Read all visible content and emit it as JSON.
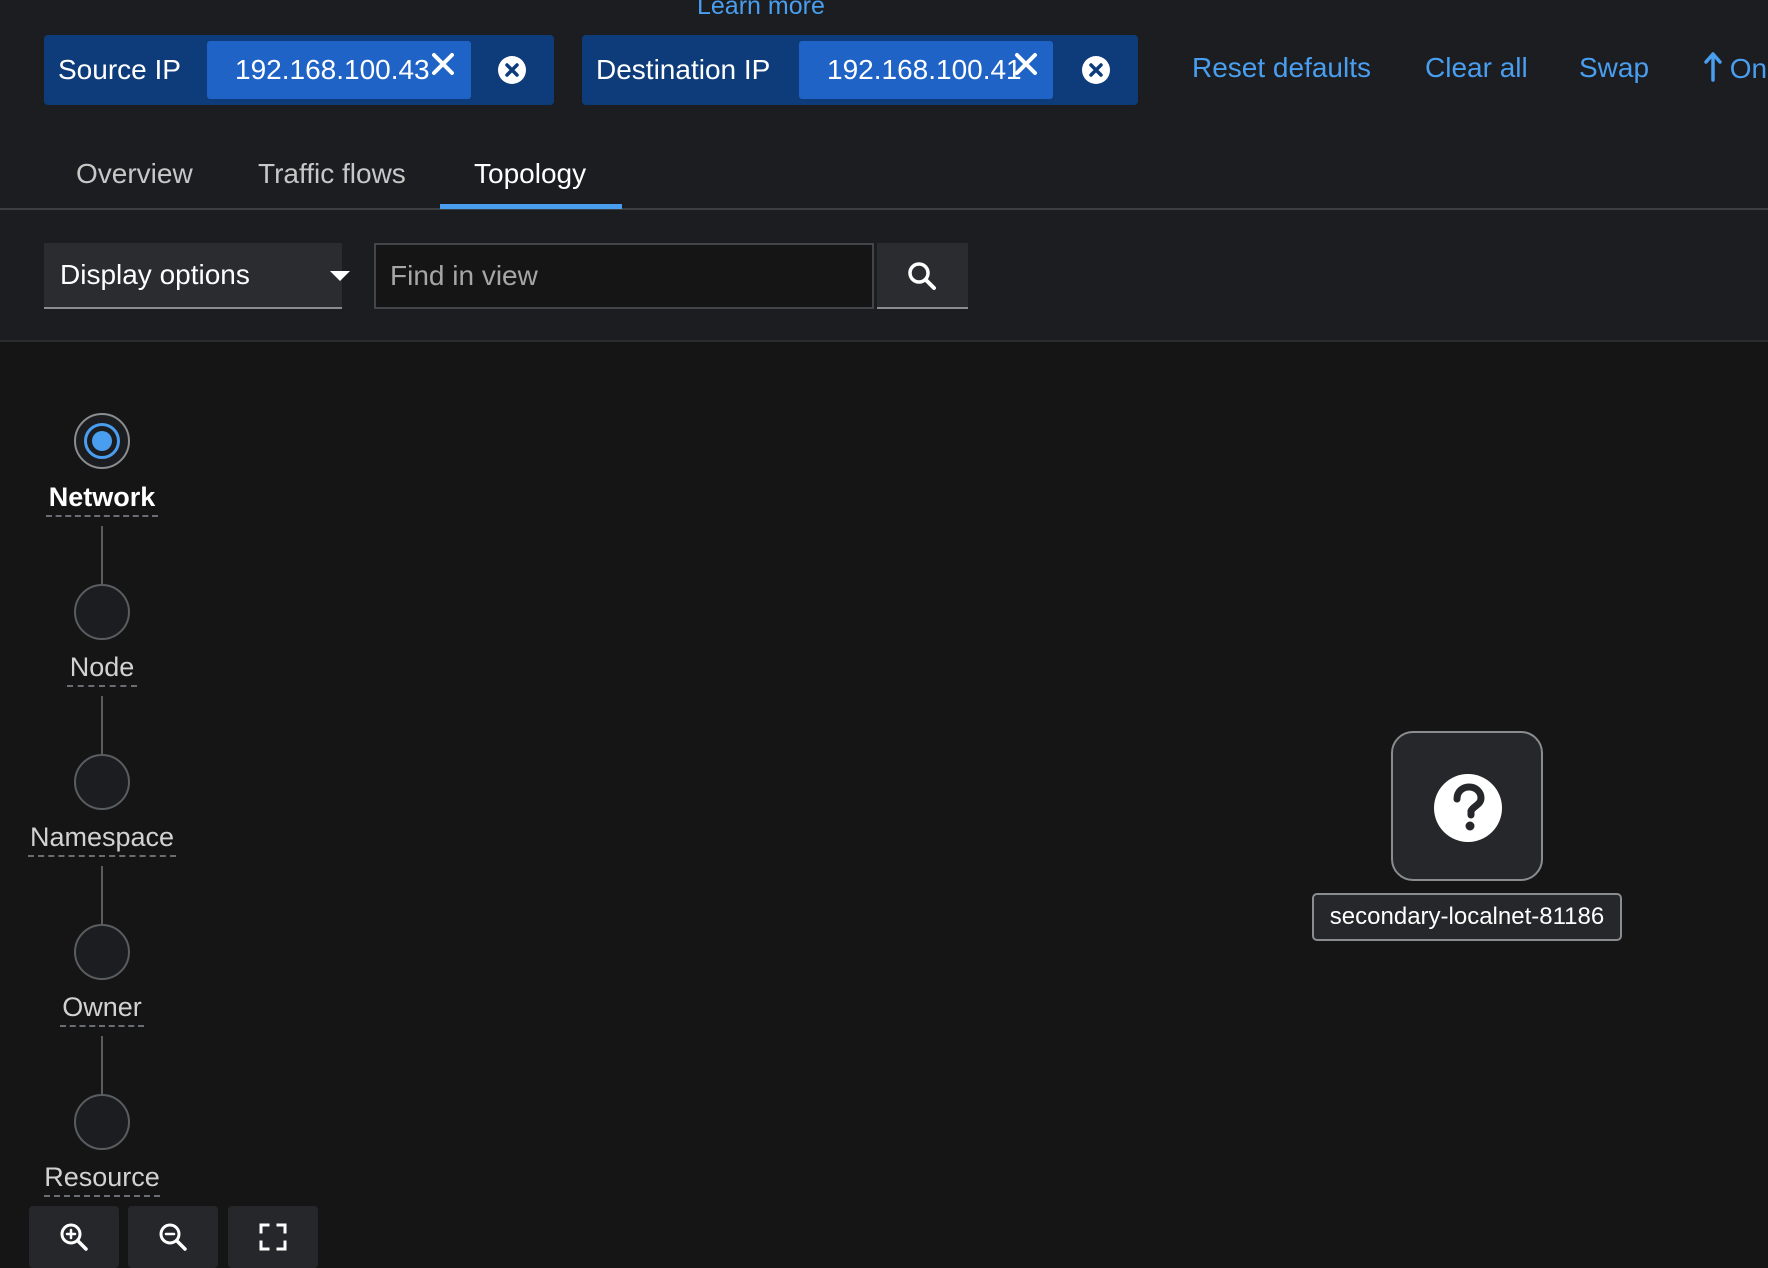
{
  "header": {
    "learn_more": "Learn more"
  },
  "filters": {
    "source": {
      "label": "Source IP",
      "value": "192.168.100.43"
    },
    "destination": {
      "label": "Destination IP",
      "value": "192.168.100.41"
    }
  },
  "toolbar": {
    "reset_defaults": "Reset defaults",
    "clear_all": "Clear all",
    "swap": "Swap",
    "one_way": "On"
  },
  "tabs": [
    {
      "label": "Overview"
    },
    {
      "label": "Traffic flows"
    },
    {
      "label": "Topology",
      "active": true
    }
  ],
  "controls": {
    "display_options": "Display options",
    "find_placeholder": "Find in view"
  },
  "scope": {
    "steps": [
      {
        "label": "Network",
        "active": true
      },
      {
        "label": "Node"
      },
      {
        "label": "Namespace"
      },
      {
        "label": "Owner"
      },
      {
        "label": "Resource"
      }
    ]
  },
  "graph": {
    "node": {
      "label": "secondary-localnet-81186",
      "icon": "question-circle-icon"
    }
  },
  "colors": {
    "accent": "#4a9eef",
    "chip_group": "#0e3c7a",
    "chip": "#1f63c6",
    "background": "#151515"
  }
}
